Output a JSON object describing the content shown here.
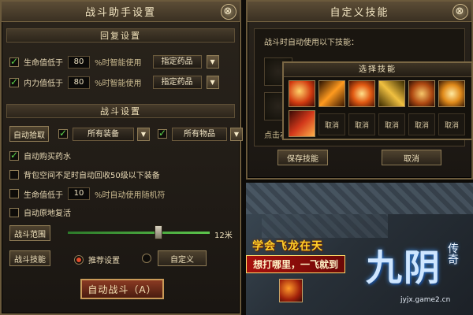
{
  "left": {
    "title": "战斗助手设置",
    "close": "⊗",
    "recovery": {
      "header": "回复设置",
      "hp": {
        "label": "生命值低于",
        "value": "80",
        "suffix": "%时智能使用",
        "select": "指定药品",
        "dd": "▼"
      },
      "mp": {
        "label": "内力值低于",
        "value": "80",
        "suffix": "%时智能使用",
        "select": "指定药品",
        "dd": "▼"
      }
    },
    "battle": {
      "header": "战斗设置",
      "autopick": "自动拾取",
      "equip_select": "所有装备",
      "item_select": "所有物品",
      "dd": "▼",
      "auto_buy": "自动购买药水",
      "bag_full": "背包空间不足时自动回收50级以下装备",
      "hp_label": "生命值低于",
      "hp_value": "10",
      "hp_suffix": "%时自动使用随机符",
      "revive": "自动原地复活",
      "range_btn": "战斗范围",
      "range_value": 12,
      "range_text": "12米",
      "skill_btn": "战斗技能",
      "radio_recommend": "推荐设置",
      "custom_btn": "自定义",
      "auto_fight": "自动战斗（A）"
    }
  },
  "right": {
    "title": "自定义技能",
    "close": "⊗",
    "desc": "战斗时自动使用以下技能：",
    "chooser_title": "选择技能",
    "cancel": "取消",
    "save_btn": "保存技能",
    "cancel_btn": "取消",
    "partial_label": "点击右"
  },
  "scene": {
    "headline": "学会飞龙在天",
    "subline": "想打哪里，一飞就到",
    "brand": "九阴",
    "brand_small": "传奇",
    "url": "jyjx.game2.cn"
  }
}
